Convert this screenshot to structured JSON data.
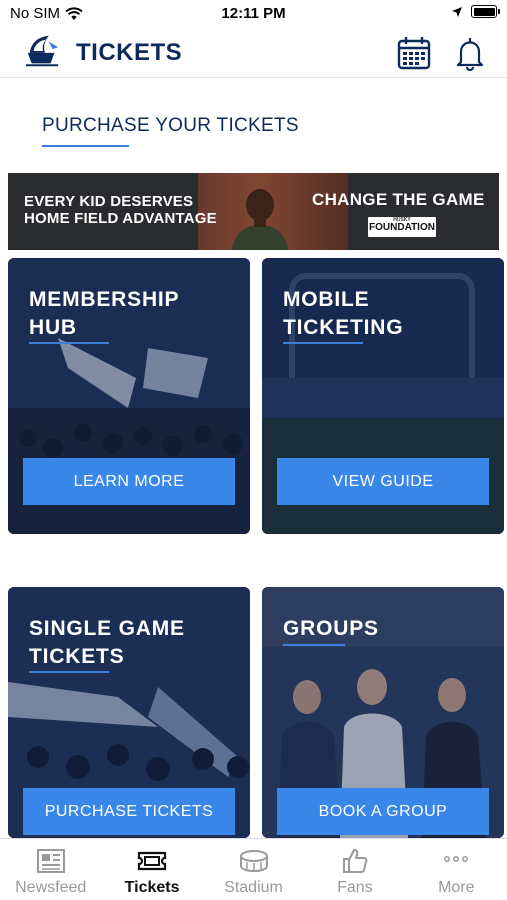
{
  "status": {
    "carrier": "No SIM",
    "time": "12:11 PM"
  },
  "header": {
    "title": "TICKETS"
  },
  "section": {
    "title": "PURCHASE YOUR TICKETS"
  },
  "banner": {
    "left_line1": "EVERY KID DESERVES",
    "left_line2": "HOME FIELD ADVANTAGE",
    "right_title": "CHANGE THE GAME",
    "badge_small": "HUSKY",
    "badge": "FOUNDATION"
  },
  "cards": [
    {
      "title_line1": "MEMBERSHIP",
      "title_line2": "HUB",
      "button": "LEARN MORE"
    },
    {
      "title_line1": "MOBILE",
      "title_line2": "TICKETING",
      "button": "VIEW GUIDE"
    },
    {
      "title_line1": "SINGLE GAME",
      "title_line2": "TICKETS",
      "button": "PURCHASE TICKETS"
    },
    {
      "title_line1": "GROUPS",
      "title_line2": "",
      "button": "BOOK A GROUP"
    }
  ],
  "tabs": [
    {
      "label": "Newsfeed",
      "icon": "newspaper-icon",
      "active": false
    },
    {
      "label": "Tickets",
      "icon": "ticket-icon",
      "active": true
    },
    {
      "label": "Stadium",
      "icon": "stadium-icon",
      "active": false
    },
    {
      "label": "Fans",
      "icon": "thumbs-up-icon",
      "active": false
    },
    {
      "label": "More",
      "icon": "more-icon",
      "active": false
    }
  ],
  "colors": {
    "brand_navy": "#0c2a5b",
    "accent_blue": "#3a87ea",
    "underline_blue": "#3f7fd9"
  }
}
